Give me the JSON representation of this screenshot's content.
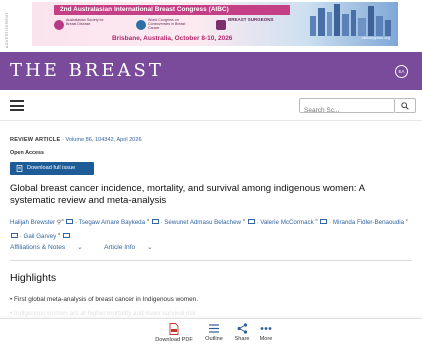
{
  "ad": {
    "side_text": "ADVERTISEMENT",
    "title": "2nd Australasian International Breast Congress (AIBC)",
    "logo1": "Australasian Society for Breast Disease",
    "logo2": "World Congress on Controversies in Breast Cancer",
    "logo3": "BREAST SURGEONS",
    "location": "Brisbane, Australia, October 8-10, 2026",
    "url": "aibcongress.org"
  },
  "journal": {
    "title": "THE BREAST",
    "badge": "EA"
  },
  "search": {
    "placeholder": "Search Sc..."
  },
  "article": {
    "type": "REVIEW ARTICLE",
    "separator": " · ",
    "volume": "Volume 86, 104342, April 2026",
    "access": "Open Access",
    "download_label": "Download full issue",
    "title": "Global breast cancer incidence, mortality, and survival among indigenous women: A systematic review and meta-analysis",
    "authors": [
      {
        "name": "Halijah Brewster",
        "sup": "a"
      },
      {
        "name": "Tsegaw Amare Baykeda",
        "sup": "a"
      },
      {
        "name": "Sewunet Admasu Belachew",
        "sup": "a"
      },
      {
        "name": "Valerie McCormack",
        "sup": "b"
      },
      {
        "name": "Miranda Fidler-Benaoudia",
        "sup": "c"
      },
      {
        "name": "Gail Garvey",
        "sup": "a"
      }
    ],
    "affiliations_label": "Affiliations & Notes",
    "article_info_label": "Article Info",
    "highlights_heading": "Highlights",
    "highlight_1": "First global meta-analysis of breast cancer in Indigenous women.",
    "highlight_2_partial": "Indigenous women are at higher mortality and lower survival risk"
  },
  "toolbar": {
    "download_pdf": "Download PDF",
    "outline": "Outline",
    "share": "Share",
    "more": "More"
  },
  "colors": {
    "journal_band": "#7a4b9a",
    "link_blue": "#3466a0",
    "button_blue": "#1e5c97",
    "ad_magenta": "#c43f85",
    "pdf_red": "#c0392b"
  }
}
